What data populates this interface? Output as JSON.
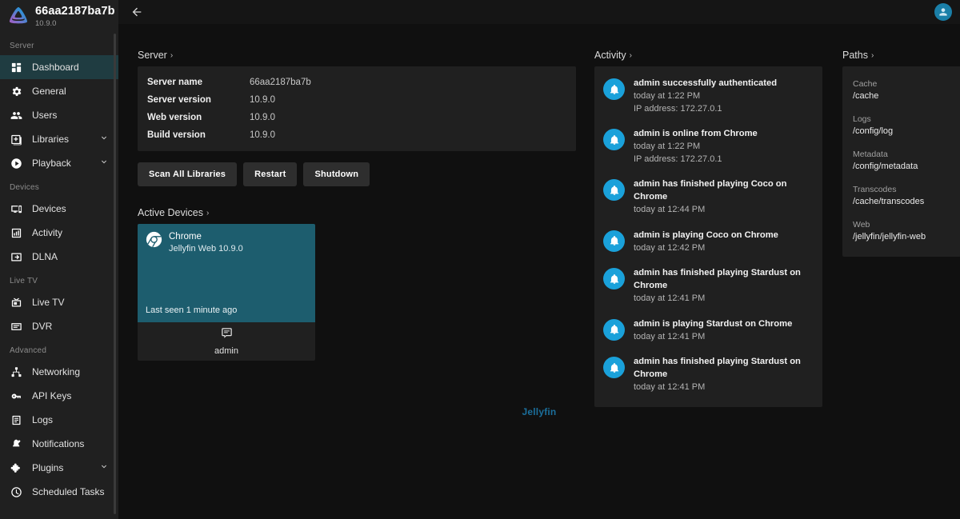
{
  "sidebar": {
    "brand": {
      "title": "66aa2187ba7b",
      "version": "10.9.0"
    },
    "groups": [
      {
        "label": "Server",
        "items": [
          {
            "label": "Dashboard",
            "icon": "dashboard-icon",
            "active": true,
            "expandable": false
          },
          {
            "label": "General",
            "icon": "gear-icon",
            "active": false,
            "expandable": false
          },
          {
            "label": "Users",
            "icon": "users-icon",
            "active": false,
            "expandable": false
          },
          {
            "label": "Libraries",
            "icon": "library-icon",
            "active": false,
            "expandable": true
          },
          {
            "label": "Playback",
            "icon": "play-icon",
            "active": false,
            "expandable": true
          }
        ]
      },
      {
        "label": "Devices",
        "items": [
          {
            "label": "Devices",
            "icon": "devices-icon",
            "active": false,
            "expandable": false
          },
          {
            "label": "Activity",
            "icon": "chart-icon",
            "active": false,
            "expandable": false
          },
          {
            "label": "DLNA",
            "icon": "dlna-icon",
            "active": false,
            "expandable": false
          }
        ]
      },
      {
        "label": "Live TV",
        "items": [
          {
            "label": "Live TV",
            "icon": "tv-icon",
            "active": false,
            "expandable": false
          },
          {
            "label": "DVR",
            "icon": "dvr-icon",
            "active": false,
            "expandable": false
          }
        ]
      },
      {
        "label": "Advanced",
        "items": [
          {
            "label": "Networking",
            "icon": "network-icon",
            "active": false,
            "expandable": false
          },
          {
            "label": "API Keys",
            "icon": "key-icon",
            "active": false,
            "expandable": false
          },
          {
            "label": "Logs",
            "icon": "logs-icon",
            "active": false,
            "expandable": false
          },
          {
            "label": "Notifications",
            "icon": "notification-icon",
            "active": false,
            "expandable": false
          },
          {
            "label": "Plugins",
            "icon": "plugin-icon",
            "active": false,
            "expandable": true
          },
          {
            "label": "Scheduled Tasks",
            "icon": "clock-icon",
            "active": false,
            "expandable": false
          }
        ]
      }
    ]
  },
  "topbar": {
    "back_icon": "arrow-left-icon",
    "avatar_icon": "person-icon"
  },
  "server": {
    "heading": "Server",
    "chevron": "›",
    "rows": [
      {
        "key": "Server name",
        "value": "66aa2187ba7b"
      },
      {
        "key": "Server version",
        "value": "10.9.0"
      },
      {
        "key": "Web version",
        "value": "10.9.0"
      },
      {
        "key": "Build version",
        "value": "10.9.0"
      }
    ],
    "buttons": [
      {
        "label": "Scan All Libraries"
      },
      {
        "label": "Restart"
      },
      {
        "label": "Shutdown"
      }
    ]
  },
  "active_devices": {
    "heading": "Active Devices",
    "chevron": "›",
    "card": {
      "device_name": "Chrome",
      "client": "Jellyfin Web 10.9.0",
      "last_seen": "Last seen 1 minute ago",
      "user": "admin",
      "user_icon": "message-icon",
      "device_icon": "chrome-icon"
    }
  },
  "activity": {
    "heading": "Activity",
    "chevron": "›",
    "items": [
      {
        "icon": "bell-icon",
        "text": "admin successfully authenticated",
        "time": "today at 1:22 PM",
        "ip": "IP address: 172.27.0.1"
      },
      {
        "icon": "bell-icon",
        "text": "admin is online from Chrome",
        "time": "today at 1:22 PM",
        "ip": "IP address: 172.27.0.1"
      },
      {
        "icon": "bell-icon",
        "text": "admin has finished playing Coco on Chrome",
        "time": "today at 12:44 PM",
        "ip": ""
      },
      {
        "icon": "bell-icon",
        "text": "admin is playing Coco on Chrome",
        "time": "today at 12:42 PM",
        "ip": ""
      },
      {
        "icon": "bell-icon",
        "text": "admin has finished playing Stardust on Chrome",
        "time": "today at 12:41 PM",
        "ip": ""
      },
      {
        "icon": "bell-icon",
        "text": "admin is playing Stardust on Chrome",
        "time": "today at 12:41 PM",
        "ip": ""
      },
      {
        "icon": "bell-icon",
        "text": "admin has finished playing Stardust on Chrome",
        "time": "today at 12:41 PM",
        "ip": ""
      }
    ]
  },
  "paths": {
    "heading": "Paths",
    "chevron": "›",
    "items": [
      {
        "key": "Cache",
        "value": "/cache"
      },
      {
        "key": "Logs",
        "value": "/config/log"
      },
      {
        "key": "Metadata",
        "value": "/config/metadata"
      },
      {
        "key": "Transcodes",
        "value": "/cache/transcodes"
      },
      {
        "key": "Web",
        "value": "/jellyfin/jellyfin-web"
      }
    ]
  },
  "footer": {
    "logo_text": "Jellyfin"
  },
  "colors": {
    "accent": "#00a4dc",
    "sidebar_active": "#1f3c41",
    "device_card": "#1d5d6e",
    "panel": "#202020",
    "page_bg": "#101010",
    "footer_logo": "#1b6f9c"
  }
}
